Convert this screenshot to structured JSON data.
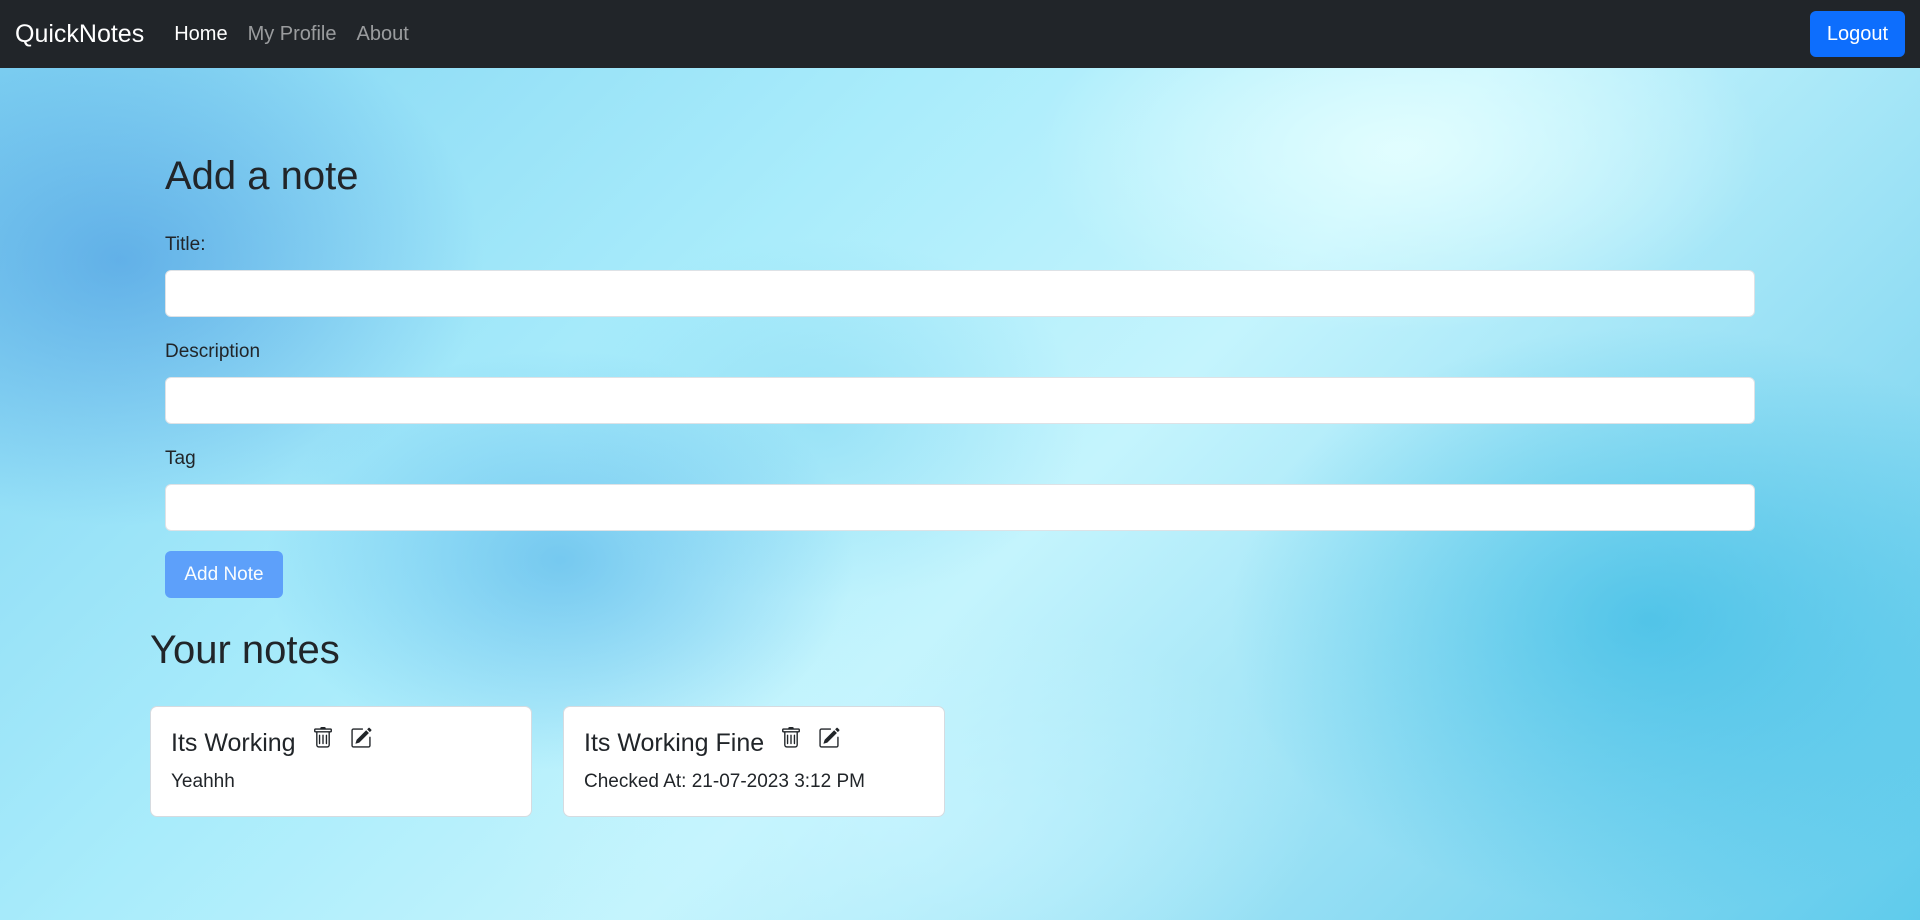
{
  "navbar": {
    "brand": "QuickNotes",
    "links": [
      {
        "label": "Home",
        "active": true
      },
      {
        "label": "My Profile",
        "active": false
      },
      {
        "label": "About",
        "active": false
      }
    ],
    "logout_label": "Logout"
  },
  "form": {
    "heading": "Add a note",
    "title_label": "Title:",
    "title_value": "",
    "description_label": "Description",
    "description_value": "",
    "tag_label": "Tag",
    "tag_value": "",
    "submit_label": "Add Note"
  },
  "notes": {
    "heading": "Your notes",
    "items": [
      {
        "title": "Its Working",
        "description": "Yeahhh",
        "icons": [
          "trash-icon",
          "edit-icon"
        ]
      },
      {
        "title": "Its Working Fine",
        "description": "Checked At: 21-07-2023 3:12 PM",
        "icons": [
          "trash-icon",
          "edit-icon"
        ]
      }
    ]
  },
  "colors": {
    "navbar_bg": "#212529",
    "primary": "#0d6efd",
    "add_button": "#5a9dfb"
  }
}
